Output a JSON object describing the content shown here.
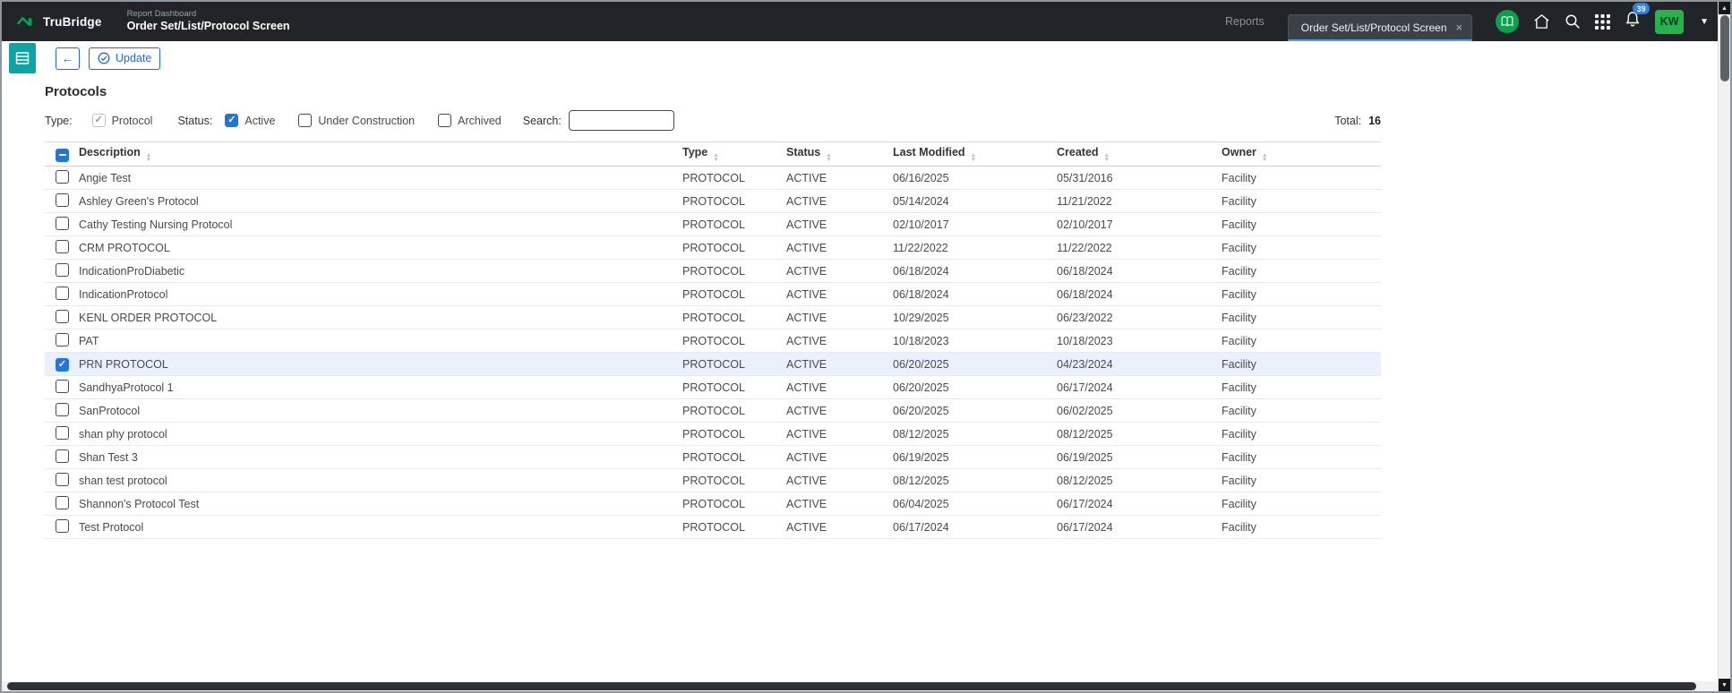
{
  "theme": {
    "header_bg": "#212529",
    "accent_blue": "#2575d8",
    "button_blue": "#1f6dbf",
    "brand_green": "#0ca04d",
    "avatar_green": "#27b24f",
    "sidebar_teal": "#11a3a3",
    "selected_row_bg": "#e9f2fc",
    "badge_blue": "#2f80ed"
  },
  "header": {
    "brand": "TruBridge",
    "breadcrumb": "Report Dashboard",
    "title": "Order Set/List/Protocol Screen",
    "reports_link": "Reports",
    "tab": {
      "label": "Order Set/List/Protocol Screen",
      "close": "×"
    },
    "notifications_count": "39",
    "avatar_initials": "KW"
  },
  "toolbar": {
    "back_label": "←",
    "update_label": "Update"
  },
  "page": {
    "heading": "Protocols",
    "type_label": "Type:",
    "protocol_label": "Protocol",
    "status_label": "Status:",
    "active_label": "Active",
    "under_construction_label": "Under Construction",
    "archived_label": "Archived",
    "search_label": "Search:",
    "total_label": "Total:",
    "total_value": "16"
  },
  "filters": {
    "protocol_checked": true,
    "active": true,
    "under_construction": false,
    "archived": false
  },
  "search": {
    "value": "",
    "placeholder": ""
  },
  "table": {
    "columns": [
      "Description",
      "Type",
      "Status",
      "Last Modified",
      "Created",
      "Owner"
    ],
    "rows": [
      {
        "checked": false,
        "description": "Angie Test",
        "type": "PROTOCOL",
        "status": "ACTIVE",
        "last_modified": "06/16/2025",
        "created": "05/31/2016",
        "owner": "Facility"
      },
      {
        "checked": false,
        "description": "Ashley Green's Protocol",
        "type": "PROTOCOL",
        "status": "ACTIVE",
        "last_modified": "05/14/2024",
        "created": "11/21/2022",
        "owner": "Facility"
      },
      {
        "checked": false,
        "description": "Cathy Testing Nursing Protocol",
        "type": "PROTOCOL",
        "status": "ACTIVE",
        "last_modified": "02/10/2017",
        "created": "02/10/2017",
        "owner": "Facility"
      },
      {
        "checked": false,
        "description": "CRM PROTOCOL",
        "type": "PROTOCOL",
        "status": "ACTIVE",
        "last_modified": "11/22/2022",
        "created": "11/22/2022",
        "owner": "Facility"
      },
      {
        "checked": false,
        "description": "IndicationProDiabetic",
        "type": "PROTOCOL",
        "status": "ACTIVE",
        "last_modified": "06/18/2024",
        "created": "06/18/2024",
        "owner": "Facility"
      },
      {
        "checked": false,
        "description": "IndicationProtocol",
        "type": "PROTOCOL",
        "status": "ACTIVE",
        "last_modified": "06/18/2024",
        "created": "06/18/2024",
        "owner": "Facility"
      },
      {
        "checked": false,
        "description": "KENL ORDER PROTOCOL",
        "type": "PROTOCOL",
        "status": "ACTIVE",
        "last_modified": "10/29/2025",
        "created": "06/23/2022",
        "owner": "Facility"
      },
      {
        "checked": false,
        "description": "PAT",
        "type": "PROTOCOL",
        "status": "ACTIVE",
        "last_modified": "10/18/2023",
        "created": "10/18/2023",
        "owner": "Facility"
      },
      {
        "checked": true,
        "description": "PRN PROTOCOL",
        "type": "PROTOCOL",
        "status": "ACTIVE",
        "last_modified": "06/20/2025",
        "created": "04/23/2024",
        "owner": "Facility"
      },
      {
        "checked": false,
        "description": "SandhyaProtocol 1",
        "type": "PROTOCOL",
        "status": "ACTIVE",
        "last_modified": "06/20/2025",
        "created": "06/17/2024",
        "owner": "Facility"
      },
      {
        "checked": false,
        "description": "SanProtocol",
        "type": "PROTOCOL",
        "status": "ACTIVE",
        "last_modified": "06/20/2025",
        "created": "06/02/2025",
        "owner": "Facility"
      },
      {
        "checked": false,
        "description": "shan phy protocol",
        "type": "PROTOCOL",
        "status": "ACTIVE",
        "last_modified": "08/12/2025",
        "created": "08/12/2025",
        "owner": "Facility"
      },
      {
        "checked": false,
        "description": "Shan Test 3",
        "type": "PROTOCOL",
        "status": "ACTIVE",
        "last_modified": "06/19/2025",
        "created": "06/19/2025",
        "owner": "Facility"
      },
      {
        "checked": false,
        "description": "shan test protocol",
        "type": "PROTOCOL",
        "status": "ACTIVE",
        "last_modified": "08/12/2025",
        "created": "08/12/2025",
        "owner": "Facility"
      },
      {
        "checked": false,
        "description": "Shannon's Protocol Test",
        "type": "PROTOCOL",
        "status": "ACTIVE",
        "last_modified": "06/04/2025",
        "created": "06/17/2024",
        "owner": "Facility"
      },
      {
        "checked": false,
        "description": "Test Protocol",
        "type": "PROTOCOL",
        "status": "ACTIVE",
        "last_modified": "06/17/2024",
        "created": "06/17/2024",
        "owner": "Facility"
      }
    ]
  }
}
